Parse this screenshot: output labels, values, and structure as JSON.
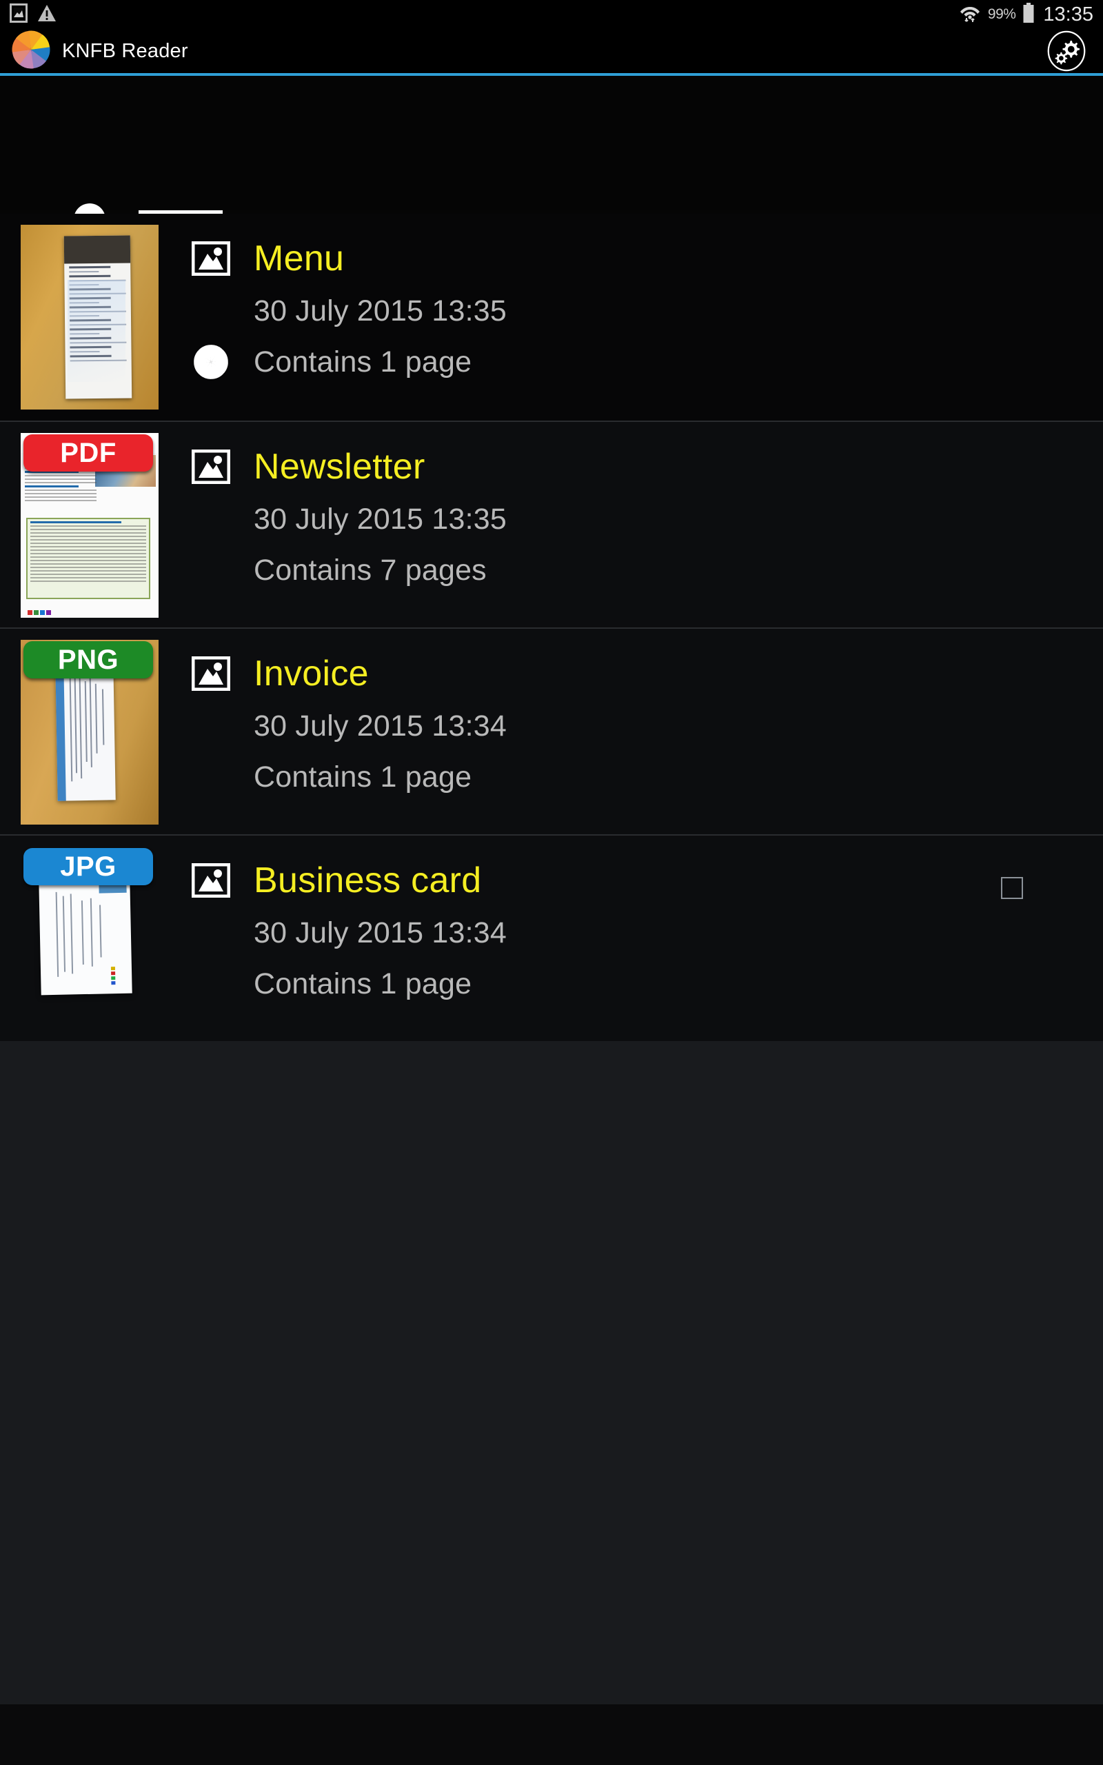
{
  "status_bar": {
    "left_icons": [
      {
        "name": "screenshot-icon",
        "label": "screenshot"
      },
      {
        "name": "warning-icon",
        "label": "warning"
      }
    ],
    "wifi_icon": "wifi-icon",
    "battery_percent": "99%",
    "battery_icon": "battery-icon",
    "clock": "13:35"
  },
  "app_bar": {
    "logo_icon": "knfb-aperture-logo-icon",
    "title": "KNFB Reader",
    "settings_icon": "settings-gears-icon",
    "accent_color": "#2f9fd6"
  },
  "list_header": {
    "view_mode_icon": "bullet-list-icon",
    "bullet_rows": 3
  },
  "colors": {
    "title_yellow": "#f5ee22",
    "meta_grey": "#b9b9b9",
    "pdf_red": "#e9242b",
    "png_green": "#1d8a26",
    "jpg_blue": "#1b87d2",
    "accent_blue": "#2f9fd6",
    "row_background": "#0c0d0f"
  },
  "documents": [
    {
      "title": "Menu",
      "date": "30 July 2015 13:35",
      "pages": "Contains 1 page",
      "format_badge": null,
      "thumbnail": "menu-thumbnail",
      "type_icon": "image-icon",
      "pages_icon": "aperture-icon",
      "checkbox": false
    },
    {
      "title": "Newsletter",
      "date": "30 July 2015 13:35",
      "pages": "Contains 7 pages",
      "format_badge": "PDF",
      "thumbnail": "newsletter-thumbnail",
      "type_icon": "image-icon",
      "pages_icon": null,
      "checkbox": false
    },
    {
      "title": "Invoice",
      "date": "30 July 2015 13:34",
      "pages": "Contains 1 page",
      "format_badge": "PNG",
      "thumbnail": "invoice-thumbnail",
      "type_icon": "image-icon",
      "pages_icon": null,
      "checkbox": false
    },
    {
      "title": "Business card",
      "date": "30 July 2015 13:34",
      "pages": "Contains 1 page",
      "format_badge": "JPG",
      "thumbnail": "business-card-thumbnail",
      "type_icon": "image-icon",
      "pages_icon": null,
      "checkbox": true
    }
  ]
}
